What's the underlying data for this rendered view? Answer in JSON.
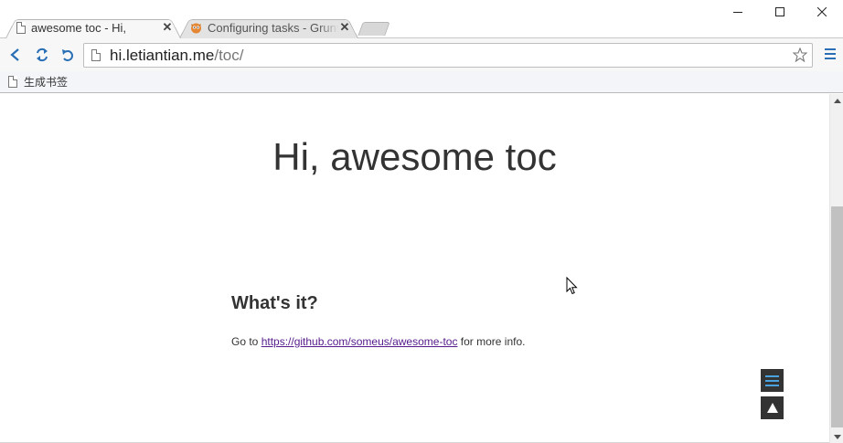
{
  "tabs": [
    {
      "title": "awesome toc - Hi,",
      "icon": "page-icon",
      "active": true
    },
    {
      "title": "Configuring tasks - Grunt",
      "icon": "grunt-icon",
      "active": false
    }
  ],
  "toolbar": {
    "url_host": "hi.letiantian.me",
    "url_path": "/toc/"
  },
  "bookmarks": [
    {
      "label": "生成书签",
      "icon": "page-icon"
    }
  ],
  "page": {
    "title": "Hi, awesome toc",
    "section_heading": "What's it?",
    "text_before": "Go to ",
    "link_text": "https://github.com/someus/awesome-toc",
    "text_after": " for more info."
  },
  "colors": {
    "link_visited": "#551a8b",
    "float_button": "#333333",
    "toc_icon_accent": "#4aa3df"
  }
}
